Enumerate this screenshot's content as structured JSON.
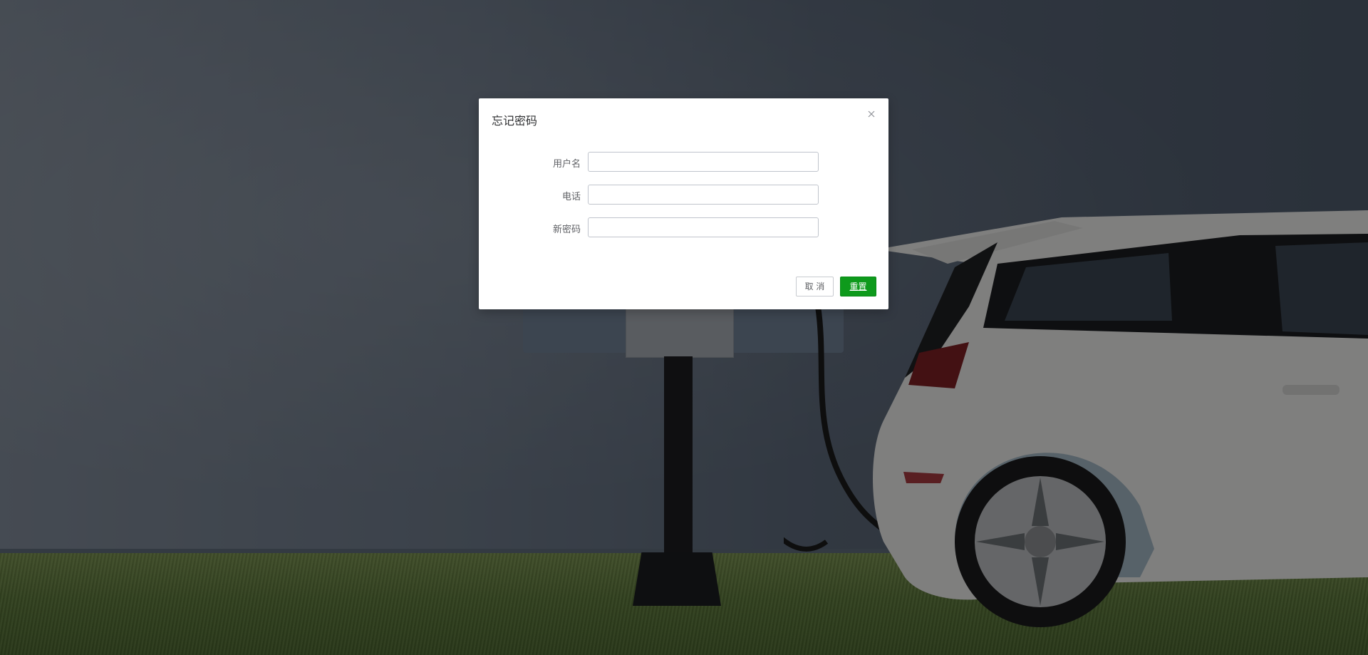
{
  "dialog": {
    "title": "忘记密码",
    "fields": [
      {
        "label": "用户名",
        "value": "",
        "placeholder": ""
      },
      {
        "label": "电话",
        "value": "",
        "placeholder": ""
      },
      {
        "label": "新密码",
        "value": "",
        "placeholder": ""
      }
    ],
    "cancel_label": "取 消",
    "confirm_label": "重置"
  },
  "colors": {
    "confirm_button": "#0e9a1c",
    "overlay": "rgba(0,0,0,0.45)"
  },
  "icons": {
    "close": "close-icon"
  }
}
